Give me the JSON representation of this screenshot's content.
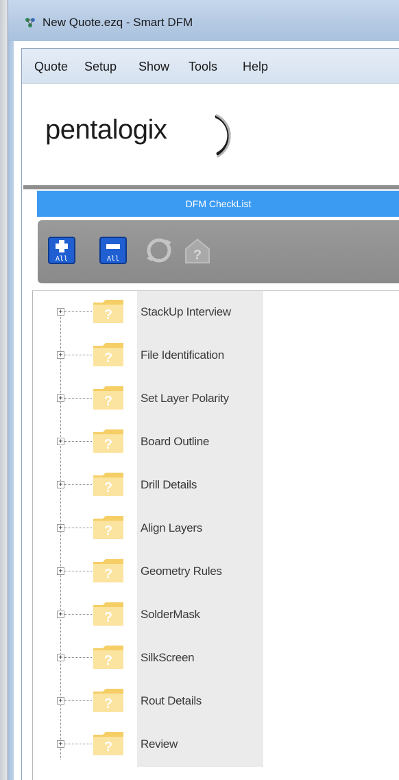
{
  "window": {
    "title": "New Quote.ezq - Smart DFM"
  },
  "menu": {
    "items": [
      "Quote",
      "Setup",
      "Show",
      "Tools",
      "Help"
    ]
  },
  "logo": {
    "text": "pentalogix"
  },
  "dfm": {
    "header": "DFM CheckList"
  },
  "toolbar": {
    "expand_all_label": "All",
    "collapse_all_label": "All",
    "icons": [
      "expand-all-icon",
      "collapse-all-icon",
      "refresh-icon",
      "help-icon"
    ]
  },
  "tree": {
    "items": [
      {
        "label": "StackUp Interview",
        "status": "unknown"
      },
      {
        "label": "File Identification",
        "status": "unknown"
      },
      {
        "label": "Set Layer Polarity",
        "status": "unknown"
      },
      {
        "label": "Board Outline",
        "status": "unknown"
      },
      {
        "label": "Drill Details",
        "status": "unknown"
      },
      {
        "label": "Align Layers",
        "status": "unknown"
      },
      {
        "label": "Geometry Rules",
        "status": "unknown"
      },
      {
        "label": "SolderMask",
        "status": "unknown"
      },
      {
        "label": "SilkScreen",
        "status": "unknown"
      },
      {
        "label": "Rout Details",
        "status": "unknown"
      },
      {
        "label": "Review",
        "status": "unknown"
      }
    ]
  },
  "colors": {
    "header_blue": "#3b9af2",
    "toolbar_gray": "#909090",
    "folder_yellow": "#f8d775",
    "button_blue": "#1f5fd1"
  }
}
